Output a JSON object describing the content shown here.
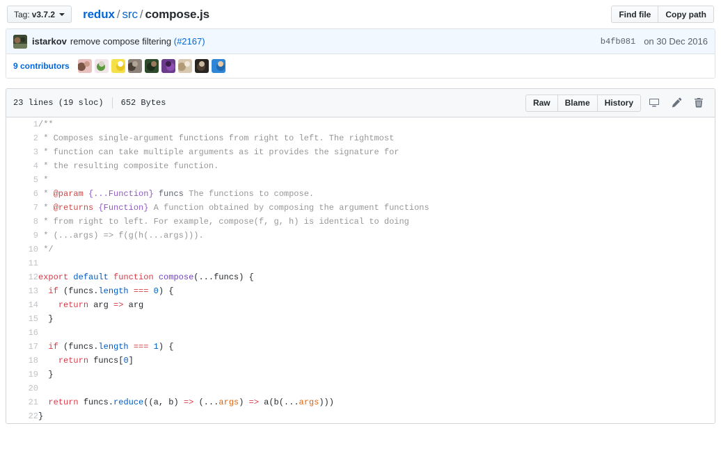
{
  "file_navigation": {
    "tag_label": "Tag:",
    "tag_value": "v3.7.2",
    "breadcrumb": {
      "repo": "redux",
      "dir": "src",
      "file": "compose.js",
      "separator": "/"
    },
    "find_file_label": "Find file",
    "copy_path_label": "Copy path"
  },
  "commit": {
    "author": "istarkov",
    "message": "remove compose filtering",
    "pr_link": "(#2167)",
    "sha": "b4fb081",
    "date": "on 30 Dec 2016"
  },
  "contributors": {
    "count_label": "9 contributors",
    "avatars": [
      {
        "name": "contributor-avatar-1",
        "c1": "#e8c0bd",
        "c2": "#7a5546",
        "c3": "#c99a8a"
      },
      {
        "name": "contributor-avatar-2",
        "c1": "#f0e6ea",
        "c2": "#5a9a3c",
        "c3": "#d8d2c6"
      },
      {
        "name": "contributor-avatar-3",
        "c1": "#f5e04a",
        "c2": "#e8c820",
        "c3": "#ffffff"
      },
      {
        "name": "contributor-avatar-4",
        "c1": "#8c8278",
        "c2": "#4a4038",
        "c3": "#b0a596"
      },
      {
        "name": "contributor-avatar-5",
        "c1": "#2d4a2a",
        "c2": "#1c2e1a",
        "c3": "#9a7a5a"
      },
      {
        "name": "contributor-avatar-6",
        "c1": "#6b3b8c",
        "c2": "#8e4fb0",
        "c3": "#3a1f4a"
      },
      {
        "name": "contributor-avatar-7",
        "c1": "#d8c8b0",
        "c2": "#b09a78",
        "c3": "#f0e8d8"
      },
      {
        "name": "contributor-avatar-8",
        "c1": "#2a2420",
        "c2": "#4a3c30",
        "c3": "#c8b8a0"
      },
      {
        "name": "contributor-avatar-9",
        "c1": "#2f86d6",
        "c2": "#1f6ab0",
        "c3": "#e8c9a8"
      }
    ]
  },
  "file_header": {
    "lines_info": "23 lines (19 sloc)",
    "size_info": "652 Bytes",
    "raw_label": "Raw",
    "blame_label": "Blame",
    "history_label": "History",
    "desktop_icon": "desktop-download-icon",
    "edit_icon": "pencil-icon",
    "delete_icon": "trashcan-icon"
  },
  "code": {
    "language": "javascript",
    "lines": [
      {
        "n": "1",
        "tokens": [
          {
            "t": "/**",
            "c": "c"
          }
        ]
      },
      {
        "n": "2",
        "tokens": [
          {
            "t": " * Composes single-argument functions from right to left. The rightmost",
            "c": "c"
          }
        ]
      },
      {
        "n": "3",
        "tokens": [
          {
            "t": " * function can take multiple arguments as it provides the signature for",
            "c": "c"
          }
        ]
      },
      {
        "n": "4",
        "tokens": [
          {
            "t": " * the resulting composite function.",
            "c": "c"
          }
        ]
      },
      {
        "n": "5",
        "tokens": [
          {
            "t": " *",
            "c": "c"
          }
        ]
      },
      {
        "n": "6",
        "tokens": [
          {
            "t": " * ",
            "c": "c"
          },
          {
            "t": "@param",
            "c": "ctag"
          },
          {
            "t": " ",
            "c": "c"
          },
          {
            "t": "{...Function}",
            "c": "ctype"
          },
          {
            "t": " ",
            "c": "c"
          },
          {
            "t": "funcs",
            "c": "cname"
          },
          {
            "t": " The functions to compose.",
            "c": "c"
          }
        ]
      },
      {
        "n": "7",
        "tokens": [
          {
            "t": " * ",
            "c": "c"
          },
          {
            "t": "@returns",
            "c": "ctag"
          },
          {
            "t": " ",
            "c": "c"
          },
          {
            "t": "{Function}",
            "c": "ctype"
          },
          {
            "t": " A function obtained by composing the argument functions",
            "c": "c"
          }
        ]
      },
      {
        "n": "8",
        "tokens": [
          {
            "t": " * from right to left. For example, compose(f, g, h) is identical to doing",
            "c": "c"
          }
        ]
      },
      {
        "n": "9",
        "tokens": [
          {
            "t": " * (...args) => f(g(h(...args))).",
            "c": "c"
          }
        ]
      },
      {
        "n": "10",
        "tokens": [
          {
            "t": " */",
            "c": "c"
          }
        ]
      },
      {
        "n": "11",
        "tokens": []
      },
      {
        "n": "12",
        "tokens": [
          {
            "t": "export",
            "c": "k"
          },
          {
            "t": " ",
            "c": "pl"
          },
          {
            "t": "default",
            "c": "kb"
          },
          {
            "t": " ",
            "c": "pl"
          },
          {
            "t": "function",
            "c": "k"
          },
          {
            "t": " ",
            "c": "pl"
          },
          {
            "t": "compose",
            "c": "fn"
          },
          {
            "t": "(...funcs) {",
            "c": "pl"
          }
        ]
      },
      {
        "n": "13",
        "tokens": [
          {
            "t": "  ",
            "c": "pl"
          },
          {
            "t": "if",
            "c": "k"
          },
          {
            "t": " (funcs.",
            "c": "pl"
          },
          {
            "t": "length",
            "c": "pr"
          },
          {
            "t": " ",
            "c": "pl"
          },
          {
            "t": "===",
            "c": "op"
          },
          {
            "t": " ",
            "c": "pl"
          },
          {
            "t": "0",
            "c": "num"
          },
          {
            "t": ") {",
            "c": "pl"
          }
        ]
      },
      {
        "n": "14",
        "tokens": [
          {
            "t": "    ",
            "c": "pl"
          },
          {
            "t": "return",
            "c": "k"
          },
          {
            "t": " arg ",
            "c": "pl"
          },
          {
            "t": "=>",
            "c": "op"
          },
          {
            "t": " arg",
            "c": "pl"
          }
        ]
      },
      {
        "n": "15",
        "tokens": [
          {
            "t": "  }",
            "c": "pl"
          }
        ]
      },
      {
        "n": "16",
        "tokens": []
      },
      {
        "n": "17",
        "tokens": [
          {
            "t": "  ",
            "c": "pl"
          },
          {
            "t": "if",
            "c": "k"
          },
          {
            "t": " (funcs.",
            "c": "pl"
          },
          {
            "t": "length",
            "c": "pr"
          },
          {
            "t": " ",
            "c": "pl"
          },
          {
            "t": "===",
            "c": "op"
          },
          {
            "t": " ",
            "c": "pl"
          },
          {
            "t": "1",
            "c": "num"
          },
          {
            "t": ") {",
            "c": "pl"
          }
        ]
      },
      {
        "n": "18",
        "tokens": [
          {
            "t": "    ",
            "c": "pl"
          },
          {
            "t": "return",
            "c": "k"
          },
          {
            "t": " funcs[",
            "c": "pl"
          },
          {
            "t": "0",
            "c": "num"
          },
          {
            "t": "]",
            "c": "pl"
          }
        ]
      },
      {
        "n": "19",
        "tokens": [
          {
            "t": "  }",
            "c": "pl"
          }
        ]
      },
      {
        "n": "20",
        "tokens": []
      },
      {
        "n": "21",
        "tokens": [
          {
            "t": "  ",
            "c": "pl"
          },
          {
            "t": "return",
            "c": "k"
          },
          {
            "t": " funcs.",
            "c": "pl"
          },
          {
            "t": "reduce",
            "c": "pr"
          },
          {
            "t": "((a, b) ",
            "c": "pl"
          },
          {
            "t": "=>",
            "c": "op"
          },
          {
            "t": " (...",
            "c": "pl"
          },
          {
            "t": "args",
            "c": "par"
          },
          {
            "t": ") ",
            "c": "pl"
          },
          {
            "t": "=>",
            "c": "op"
          },
          {
            "t": " a(b(...",
            "c": "pl"
          },
          {
            "t": "args",
            "c": "par"
          },
          {
            "t": ")))",
            "c": "pl"
          }
        ]
      },
      {
        "n": "22",
        "tokens": [
          {
            "t": "}",
            "c": "pl"
          }
        ]
      }
    ]
  }
}
